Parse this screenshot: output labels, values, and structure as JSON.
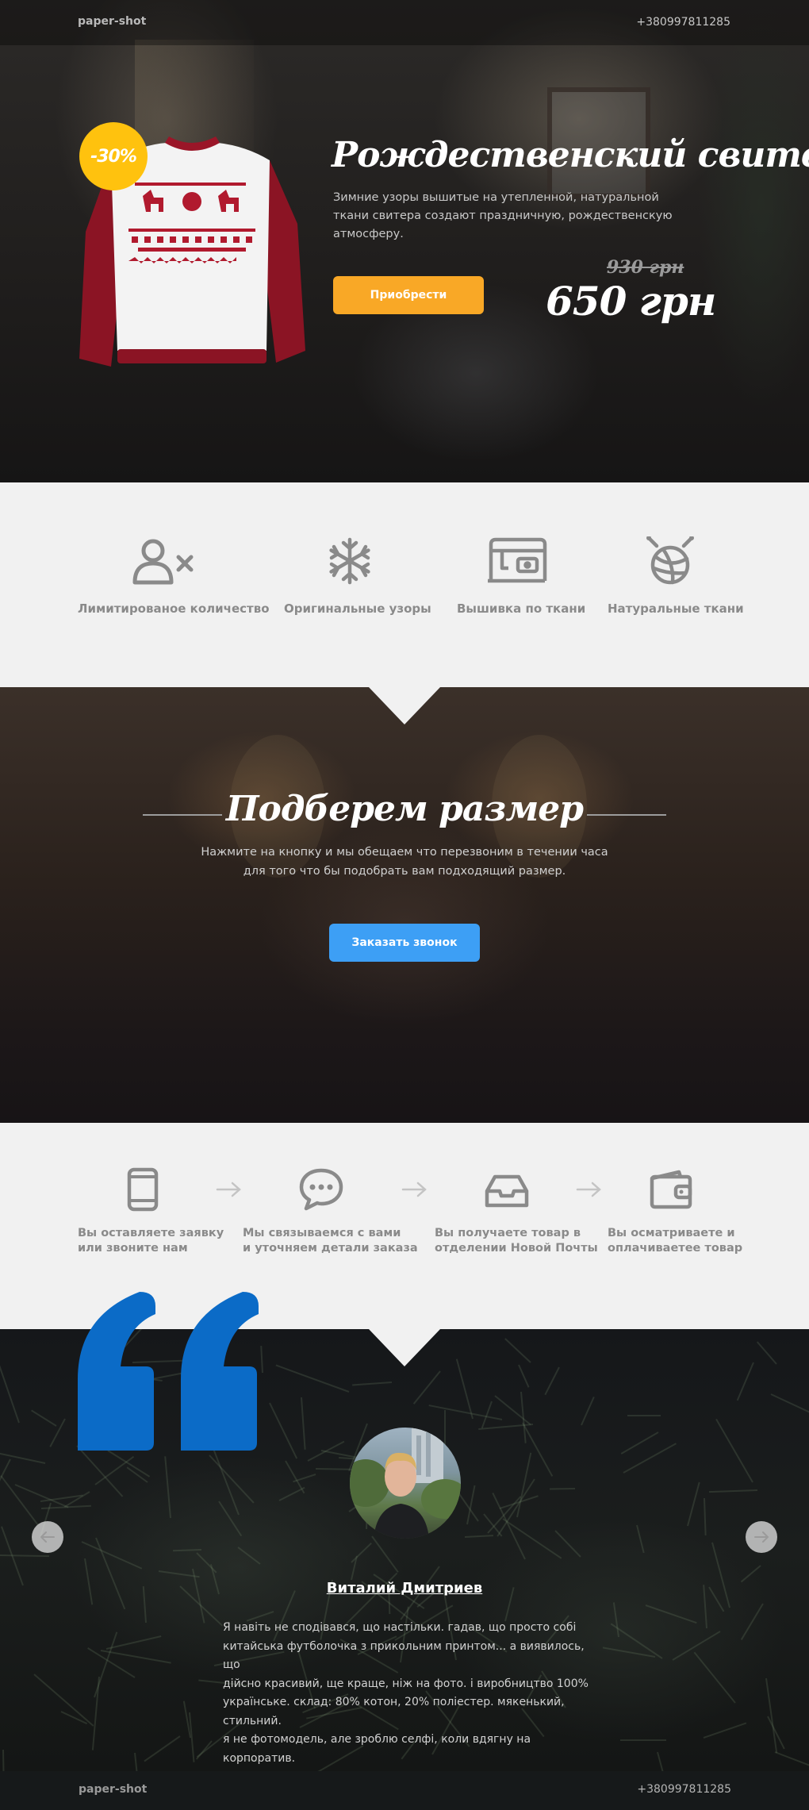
{
  "header": {
    "brand": "paper-shot",
    "phone": "+380997811285"
  },
  "hero": {
    "discount": "-30%",
    "title": "Рождественский свитер",
    "description": "Зимние узоры вышитые на утепленной, натуральной ткани свитера создают праздничную, рождественскую атмосферу.",
    "buy_label": "Приобрести",
    "old_price": "930 грн",
    "new_price": "650 грн"
  },
  "features": [
    {
      "label": "Лимитированое количество",
      "icon": "limited-user-icon"
    },
    {
      "label": "Оригинальные узоры",
      "icon": "snowflake-icon"
    },
    {
      "label": "Вышивка по ткани",
      "icon": "sewing-machine-icon"
    },
    {
      "label": "Натуральные ткани",
      "icon": "yarn-ball-icon"
    }
  ],
  "size_section": {
    "title": "Подберем размер",
    "description_line1": "Нажмите на кнопку и мы обещаем что перезвоним в течении часа",
    "description_line2": "для того что бы подобрать вам подходящий размер.",
    "call_label": "Заказать звонок"
  },
  "steps": [
    {
      "line1": "Вы оставляете заявку",
      "line2": "или звоните нам",
      "icon": "smartphone-icon"
    },
    {
      "line1": "Мы связываемся с вами",
      "line2": "и уточняем детали заказа",
      "icon": "chat-bubble-icon"
    },
    {
      "line1": "Вы получаете товар в",
      "line2": "отделении Новой Почты",
      "icon": "inbox-tray-icon"
    },
    {
      "line1": "Вы осматриваете и",
      "line2": "оплачиваетее товар",
      "icon": "wallet-icon"
    }
  ],
  "testimonial": {
    "name": "Виталий Дмитриев",
    "text_lines": [
      "Я навіть не сподівався, що настільки. гадав, що просто собі",
      "китайська футболочка з прикольним принтом... а виявилось, що",
      "дійсно красивий, ще краще, ніж на фото. і виробництво 100%",
      "українське. склад: 80% котон, 20% поліестер. мякенький, стильний.",
      "я не фотомодель, але зроблю селфі, коли вдягну на корпоратив."
    ]
  },
  "footer": {
    "brand": "paper-shot",
    "phone": "+380997811285"
  },
  "colors": {
    "accent_orange": "#f9a826",
    "badge_yellow": "#ffc20e",
    "call_blue": "#3d9ff5",
    "quote_blue": "#0b6bc7",
    "icon_gray": "#8a8a8a"
  }
}
